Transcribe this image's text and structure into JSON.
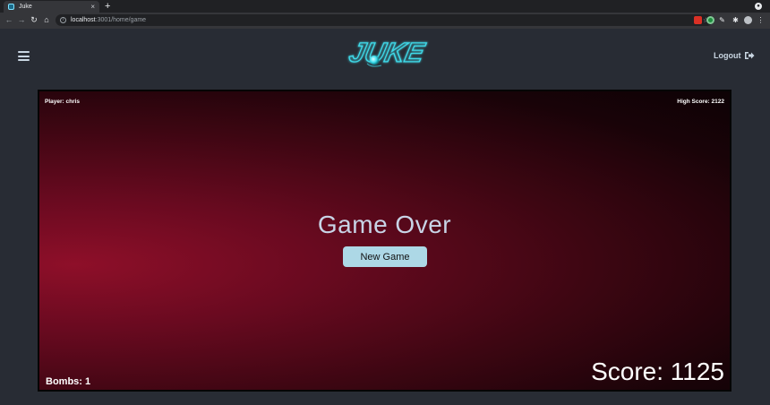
{
  "browser": {
    "tab_title": "Juke",
    "new_tab_label": "+",
    "tab_close_label": "×",
    "url_host": "localhost",
    "url_rest": ":3001/home/game"
  },
  "header": {
    "logo_text": "JUKE",
    "logout_label": "Logout"
  },
  "game": {
    "player_label": "Player: chris",
    "high_score_label": "High Score: 2122",
    "status_text": "Game Over",
    "new_game_label": "New Game",
    "bombs_label": "Bombs: 1",
    "score_label": "Score: 1125"
  },
  "colors": {
    "page_bg": "#282c34",
    "accent": "#add8e6",
    "board_glow": "#8e0f29",
    "logo_neon": "#3fe0ef"
  }
}
